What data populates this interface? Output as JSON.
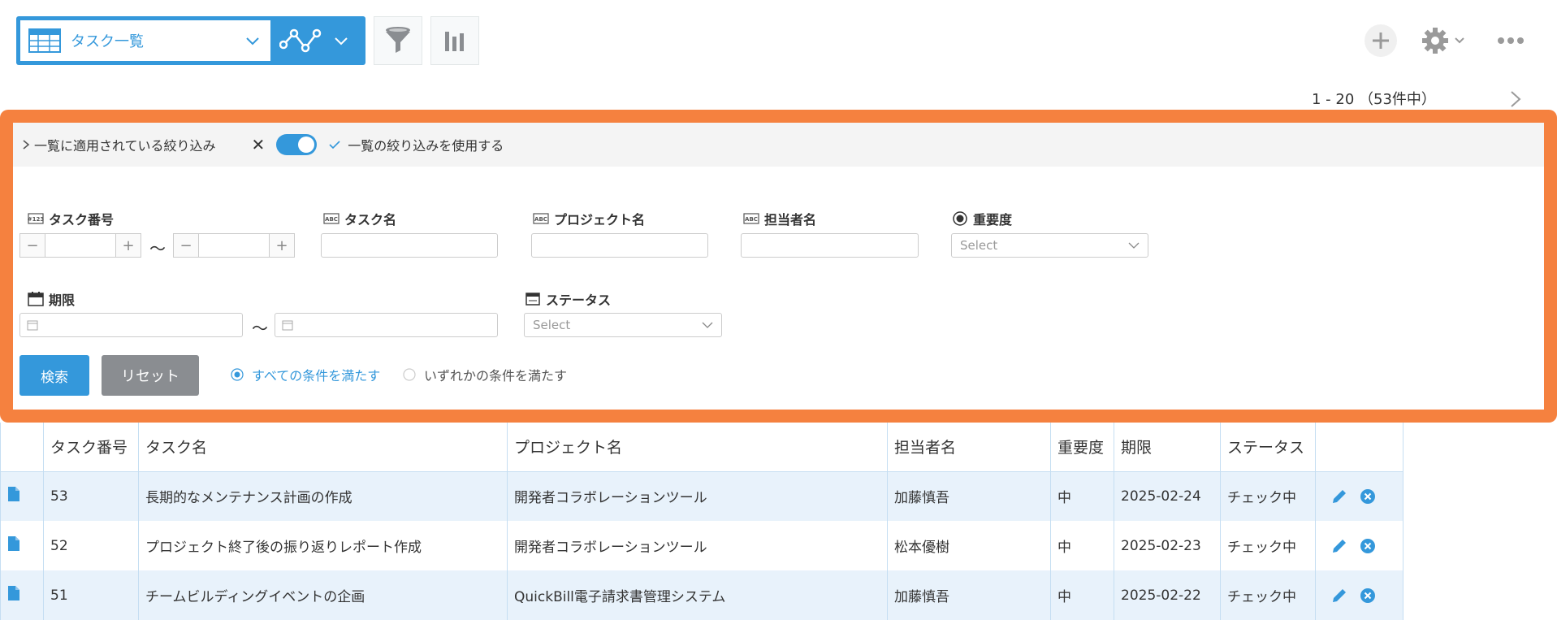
{
  "toolbar": {
    "view_name": "タスク一覧"
  },
  "pager": {
    "range": "1 - 20 （53件中）"
  },
  "filter": {
    "applied_label": "一覧に適用されている絞り込み",
    "use_label": "一覧の絞り込みを使用する",
    "toggle_on": true,
    "fields": {
      "task_no": "タスク番号",
      "task_name": "タスク名",
      "project_name": "プロジェクト名",
      "assignee": "担当者名",
      "priority": "重要度",
      "due": "期限",
      "status": "ステータス"
    },
    "tilde": "〜",
    "select_placeholder": "Select",
    "search_button": "検索",
    "reset_button": "リセット",
    "match_all": "すべての条件を満たす",
    "match_any": "いずれかの条件を満たす",
    "selected_match": "all"
  },
  "table": {
    "headers": [
      "タスク番号",
      "タスク名",
      "プロジェクト名",
      "担当者名",
      "重要度",
      "期限",
      "ステータス"
    ],
    "rows": [
      [
        "53",
        "長期的なメンテナンス計画の作成",
        "開発者コラボレーションツール",
        "加藤慎吾",
        "中",
        "2025-02-24",
        "チェック中"
      ],
      [
        "52",
        "プロジェクト終了後の振り返りレポート作成",
        "開発者コラボレーションツール",
        "松本優樹",
        "中",
        "2025-02-23",
        "チェック中"
      ],
      [
        "51",
        "チームビルディングイベントの企画",
        "QuickBill電子請求書管理システム",
        "加藤慎吾",
        "中",
        "2025-02-22",
        "チェック中"
      ]
    ]
  },
  "colors": {
    "accent": "#3498db",
    "frame": "#f5813f",
    "row_alt": "#e8f2fb"
  }
}
